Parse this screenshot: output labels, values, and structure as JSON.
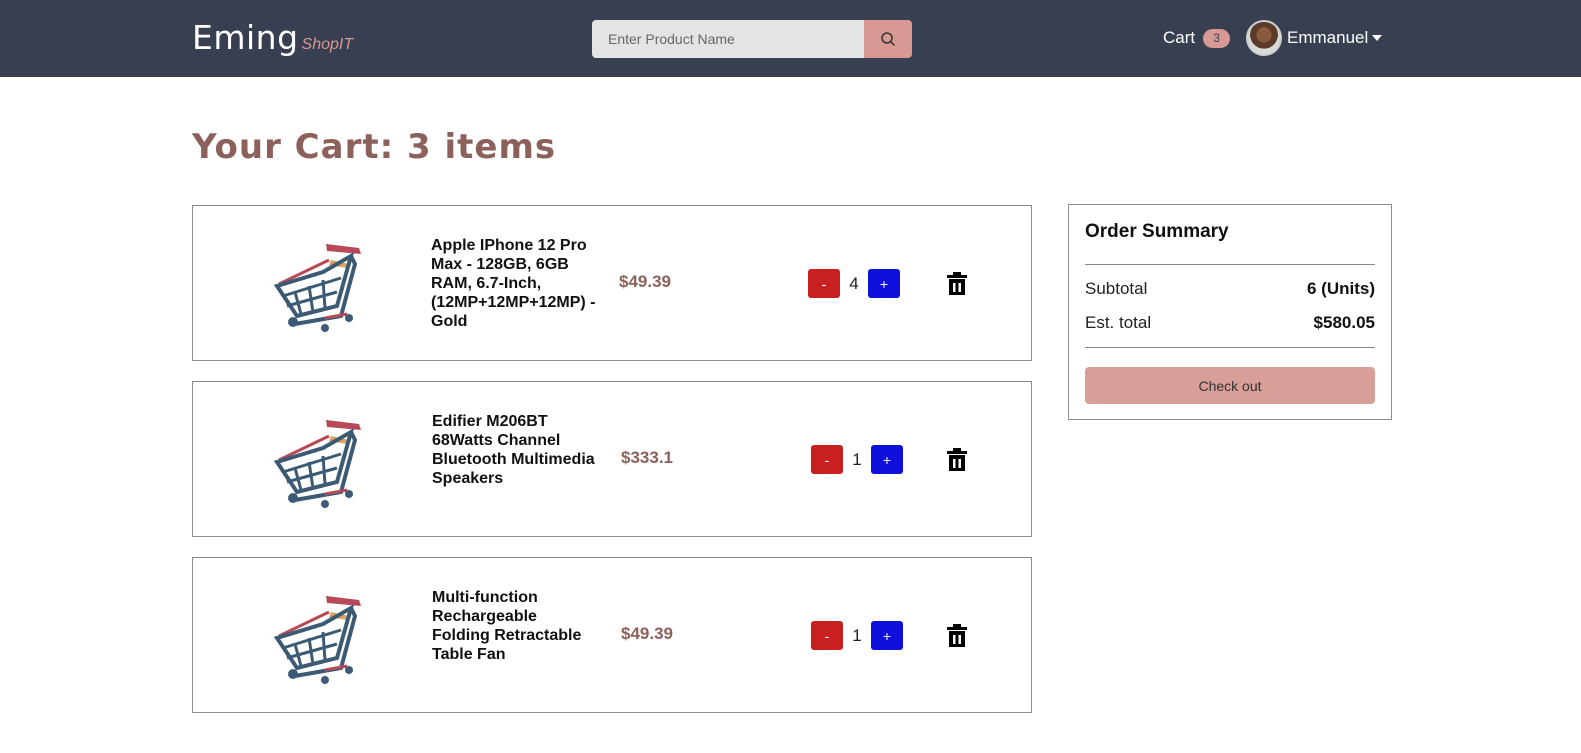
{
  "brand": {
    "name": "Eming",
    "tagline": "ShopIT"
  },
  "search": {
    "placeholder": "Enter Product Name",
    "value": ""
  },
  "nav": {
    "cart_label": "Cart",
    "cart_count": "3",
    "user_name": "Emmanuel"
  },
  "page": {
    "title": "Your Cart: 3 items"
  },
  "cart": {
    "items": [
      {
        "name": "Apple IPhone 12 Pro Max - 128GB, 6GB RAM, 6.7-Inch, (12MP+12MP+12MP) - Gold",
        "price": "$49.39",
        "quantity": "4",
        "minus_label": "-",
        "plus_label": "+"
      },
      {
        "name": "Edifier M206BT 68Watts Channel Bluetooth Multimedia Speakers",
        "price": "$333.1",
        "quantity": "1",
        "minus_label": "-",
        "plus_label": "+"
      },
      {
        "name": "Multi-function Rechargeable Folding Retractable Table Fan",
        "price": "$49.39",
        "quantity": "1",
        "minus_label": "-",
        "plus_label": "+"
      }
    ]
  },
  "summary": {
    "title": "Order Summary",
    "subtotal_label": "Subtotal",
    "subtotal_value": "6 (Units)",
    "total_label": "Est. total",
    "total_value": "$580.05",
    "checkout_label": "Check out"
  },
  "colors": {
    "navbar": "#383f51",
    "accent": "#d89994",
    "title": "#8c615c",
    "minus": "#c82020",
    "plus": "#1010dd"
  },
  "icons": {
    "search": "search-icon",
    "trash": "trash-icon",
    "caret": "caret-down-icon",
    "product": "shopping-cart-icon"
  }
}
